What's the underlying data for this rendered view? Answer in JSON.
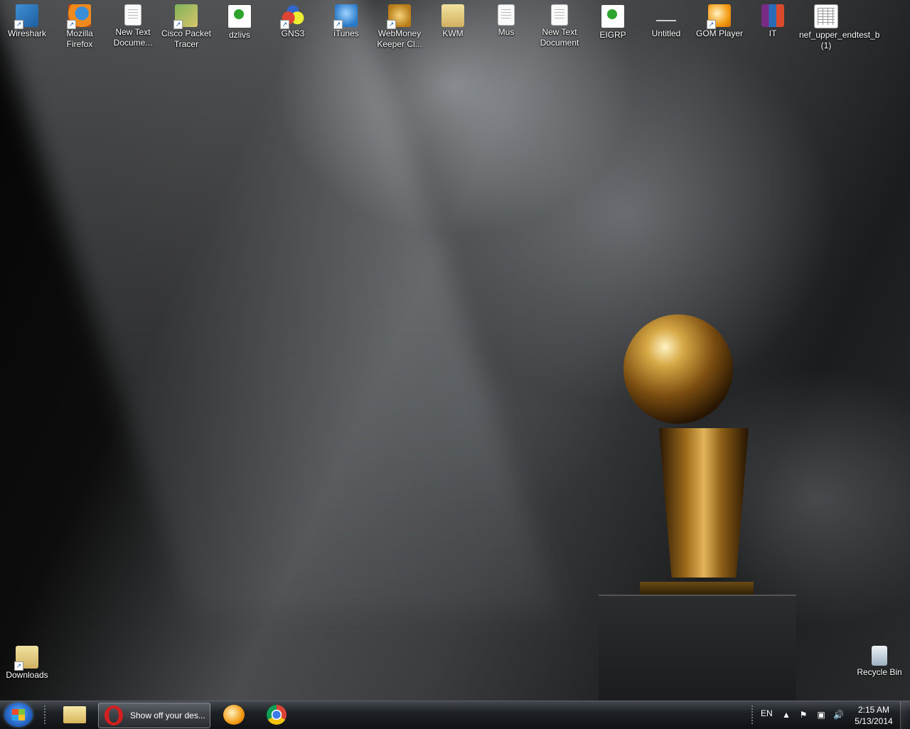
{
  "desktop": {
    "icons": [
      {
        "label": "Wireshark",
        "icon": "wireshark-icon"
      },
      {
        "label": "Mozilla Firefox",
        "icon": "firefox-icon"
      },
      {
        "label": "New Text Docume...",
        "icon": "text-document-icon"
      },
      {
        "label": "Cisco Packet Tracer",
        "icon": "packet-tracer-icon"
      },
      {
        "label": "dzlivs",
        "icon": "network-capture-icon"
      },
      {
        "label": "GNS3",
        "icon": "gns3-icon"
      },
      {
        "label": "iTunes",
        "icon": "itunes-icon"
      },
      {
        "label": "WebMoney Keeper Cl...",
        "icon": "webmoney-icon"
      },
      {
        "label": "KWM",
        "icon": "folder-icon"
      },
      {
        "label": "Mus",
        "icon": "text-document-icon"
      },
      {
        "label": "New Text Document",
        "icon": "text-document-icon"
      },
      {
        "label": "EIGRP",
        "icon": "network-capture-icon"
      },
      {
        "label": "Untitled",
        "icon": "blank-file-icon"
      },
      {
        "label": "GOM Player",
        "icon": "gom-player-icon"
      },
      {
        "label": "IT",
        "icon": "winrar-archive-icon"
      },
      {
        "label": "nef_upper_endtest_b (1)",
        "icon": "spreadsheet-icon"
      }
    ],
    "downloads": {
      "label": "Downloads",
      "icon": "downloads-folder-icon"
    },
    "recycle_bin": {
      "label": "Recycle Bin",
      "icon": "recycle-bin-icon"
    }
  },
  "taskbar": {
    "start": {
      "icon": "windows-start-icon"
    },
    "pinned": [
      {
        "name": "explorer",
        "icon": "folder-icon"
      },
      {
        "name": "opera",
        "icon": "opera-icon",
        "label": "Show off your des..."
      },
      {
        "name": "gom-player",
        "icon": "gom-player-icon"
      },
      {
        "name": "chrome",
        "icon": "chrome-icon"
      }
    ],
    "tray": {
      "language": "EN",
      "time": "2:15 AM",
      "date": "5/13/2014"
    }
  }
}
